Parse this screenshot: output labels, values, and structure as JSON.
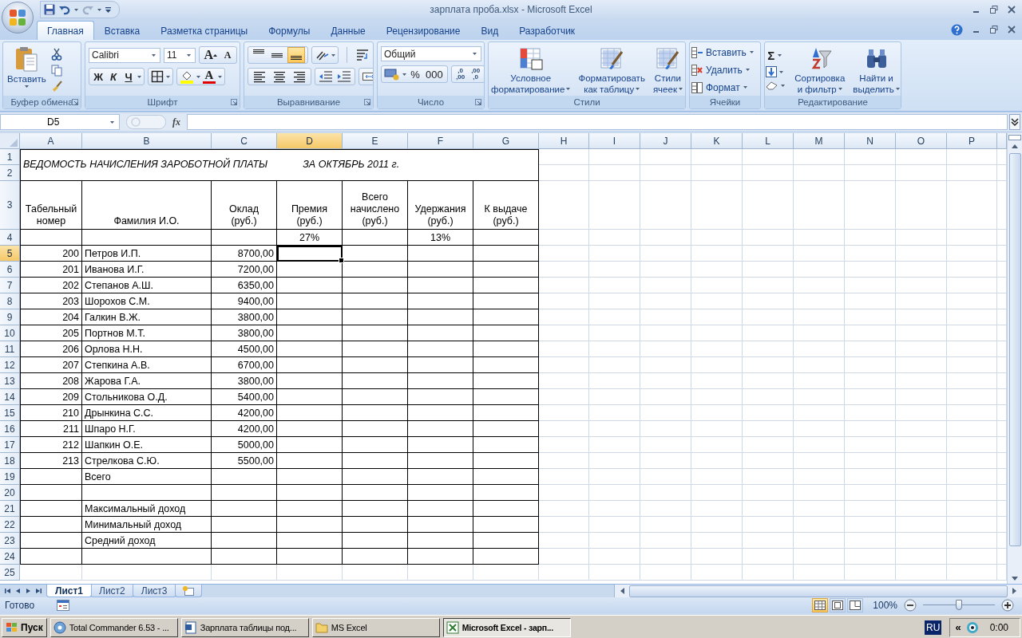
{
  "window": {
    "title": "зарплата проба.xlsx - Microsoft Excel"
  },
  "tabs": [
    {
      "label": "Главная",
      "selected": true
    },
    {
      "label": "Вставка",
      "selected": false
    },
    {
      "label": "Разметка страницы",
      "selected": false
    },
    {
      "label": "Формулы",
      "selected": false
    },
    {
      "label": "Данные",
      "selected": false
    },
    {
      "label": "Рецензирование",
      "selected": false
    },
    {
      "label": "Вид",
      "selected": false
    },
    {
      "label": "Разработчик",
      "selected": false
    }
  ],
  "ribbon": {
    "clipboard": {
      "label": "Буфер обмена",
      "paste": "Вставить"
    },
    "font": {
      "label": "Шрифт",
      "font_name": "Calibri",
      "font_size": "11",
      "grow": "A",
      "shrink": "A",
      "bold": "Ж",
      "italic": "К",
      "underline": "Ч",
      "font_color": "A"
    },
    "alignment": {
      "label": "Выравнивание",
      "vertical_buttons": [
        {
          "selected": false
        },
        {
          "selected": false
        },
        {
          "selected": true
        }
      ]
    },
    "number": {
      "label": "Число",
      "format": "Общий",
      "percent": "%",
      "thousands": "000",
      "increase_decimal": [
        ",0",
        ",00"
      ],
      "decrease_decimal": [
        ",00",
        ",0"
      ]
    },
    "styles": {
      "label": "Стили",
      "buttons": [
        {
          "lines": [
            "Условное",
            "форматирование"
          ]
        },
        {
          "lines": [
            "Форматировать",
            "как таблицу"
          ]
        },
        {
          "lines": [
            "Стили",
            "ячеек"
          ]
        }
      ]
    },
    "cells": {
      "label": "Ячейки",
      "buttons": [
        "Вставить",
        "Удалить",
        "Формат"
      ]
    },
    "editing": {
      "label": "Редактирование",
      "sum": "Σ",
      "sort": [
        "Сортировка",
        "и фильтр"
      ],
      "find": [
        "Найти и",
        "выделить"
      ]
    }
  },
  "formula_bar": {
    "name_box": "D5",
    "fx": "fx"
  },
  "sheet": {
    "columns": [
      {
        "label": "A",
        "selected": false
      },
      {
        "label": "B",
        "selected": false
      },
      {
        "label": "C",
        "selected": false
      },
      {
        "label": "D",
        "selected": true
      },
      {
        "label": "E",
        "selected": false
      },
      {
        "label": "F",
        "selected": false
      },
      {
        "label": "G",
        "selected": false
      },
      {
        "label": "H",
        "selected": false
      },
      {
        "label": "I",
        "selected": false
      },
      {
        "label": "J",
        "selected": false
      },
      {
        "label": "K",
        "selected": false
      },
      {
        "label": "L",
        "selected": false
      },
      {
        "label": "M",
        "selected": false
      },
      {
        "label": "N",
        "selected": false
      },
      {
        "label": "O",
        "selected": false
      },
      {
        "label": "P",
        "selected": false
      }
    ],
    "title": [
      "ВЕДОМОСТЬ НАЧИСЛЕНИЯ ЗАРОБОТНОЙ ПЛАТЫ",
      "ЗА ОКТЯБРЬ 2011 г."
    ],
    "rows": [
      {
        "num": "1",
        "kind": "title",
        "selected": false
      },
      {
        "num": "2",
        "kind": "title",
        "selected": false
      },
      {
        "num": "3",
        "kind": "header",
        "selected": false,
        "cells": [
          "Табельный\nномер",
          "Фамилия И.О.",
          "Оклад\n(руб.)",
          "Премия\n(руб.)",
          "Всего\nначислено\n(руб.)",
          "Удержания\n(руб.)",
          "К выдаче\n(руб.)"
        ]
      },
      {
        "num": "4",
        "kind": "data",
        "selected": false,
        "cells": [
          null,
          null,
          null,
          "27%",
          null,
          "13%"
        ]
      },
      {
        "num": "5",
        "kind": "data",
        "selected": true,
        "cells": [
          "200",
          "Петров И.П.",
          "8700,00"
        ]
      },
      {
        "num": "6",
        "kind": "data",
        "selected": false,
        "cells": [
          "201",
          "Иванова И.Г.",
          "7200,00"
        ]
      },
      {
        "num": "7",
        "kind": "data",
        "selected": false,
        "cells": [
          "202",
          "Степанов А.Ш.",
          "6350,00"
        ]
      },
      {
        "num": "8",
        "kind": "data",
        "selected": false,
        "cells": [
          "203",
          "Шорохов С.М.",
          "9400,00"
        ]
      },
      {
        "num": "9",
        "kind": "data",
        "selected": false,
        "cells": [
          "204",
          "Галкин В.Ж.",
          "3800,00"
        ]
      },
      {
        "num": "10",
        "kind": "data",
        "selected": false,
        "cells": [
          "205",
          "Портнов М.Т.",
          "3800,00"
        ]
      },
      {
        "num": "11",
        "kind": "data",
        "selected": false,
        "cells": [
          "206",
          "Орлова Н.Н.",
          "4500,00"
        ]
      },
      {
        "num": "12",
        "kind": "data",
        "selected": false,
        "cells": [
          "207",
          "Степкина А.В.",
          "6700,00"
        ]
      },
      {
        "num": "13",
        "kind": "data",
        "selected": false,
        "cells": [
          "208",
          "Жарова Г.А.",
          "3800,00"
        ]
      },
      {
        "num": "14",
        "kind": "data",
        "selected": false,
        "cells": [
          "209",
          "Стольникова О.Д.",
          "5400,00"
        ]
      },
      {
        "num": "15",
        "kind": "data",
        "selected": false,
        "cells": [
          "210",
          "Дрынкина С.С.",
          "4200,00"
        ]
      },
      {
        "num": "16",
        "kind": "data",
        "selected": false,
        "cells": [
          "211",
          "Шпаро Н.Г.",
          "4200,00"
        ]
      },
      {
        "num": "17",
        "kind": "data",
        "selected": false,
        "cells": [
          "212",
          "Шапкин О.Е.",
          "5000,00"
        ]
      },
      {
        "num": "18",
        "kind": "data",
        "selected": false,
        "cells": [
          "213",
          "Стрелкова С.Ю.",
          "5500,00"
        ]
      },
      {
        "num": "19",
        "kind": "data",
        "selected": false,
        "cells": [
          null,
          "Всего"
        ]
      },
      {
        "num": "20",
        "kind": "data",
        "selected": false
      },
      {
        "num": "21",
        "kind": "data",
        "selected": false,
        "cells": [
          null,
          "Максимальный доход"
        ]
      },
      {
        "num": "22",
        "kind": "data",
        "selected": false,
        "cells": [
          null,
          "Минимальный доход"
        ]
      },
      {
        "num": "23",
        "kind": "data",
        "selected": false,
        "cells": [
          null,
          "Средний доход"
        ]
      },
      {
        "num": "24",
        "kind": "data",
        "selected": false
      },
      {
        "num": "25",
        "kind": "plain",
        "selected": false
      }
    ]
  },
  "sheet_tabs": [
    {
      "label": "Лист1",
      "selected": true
    },
    {
      "label": "Лист2",
      "selected": false
    },
    {
      "label": "Лист3",
      "selected": false
    }
  ],
  "status_bar": {
    "status": "Готово",
    "views": [
      {
        "selected": true
      },
      {
        "selected": false
      },
      {
        "selected": false
      }
    ],
    "zoom": "100%",
    "zoom_slider": {
      "level": 0.5
    }
  },
  "taskbar": {
    "start": "Пуск",
    "tasks": [
      {
        "label": "Total Commander 6.53 - ...",
        "selected": false
      },
      {
        "label": "Зарплата таблицы под...",
        "selected": false
      },
      {
        "label": "MS Excel",
        "selected": false
      },
      {
        "label": "Microsoft Excel - зарп...",
        "selected": true
      }
    ],
    "chevron": "«",
    "language": "RU",
    "clock": "0:00"
  }
}
